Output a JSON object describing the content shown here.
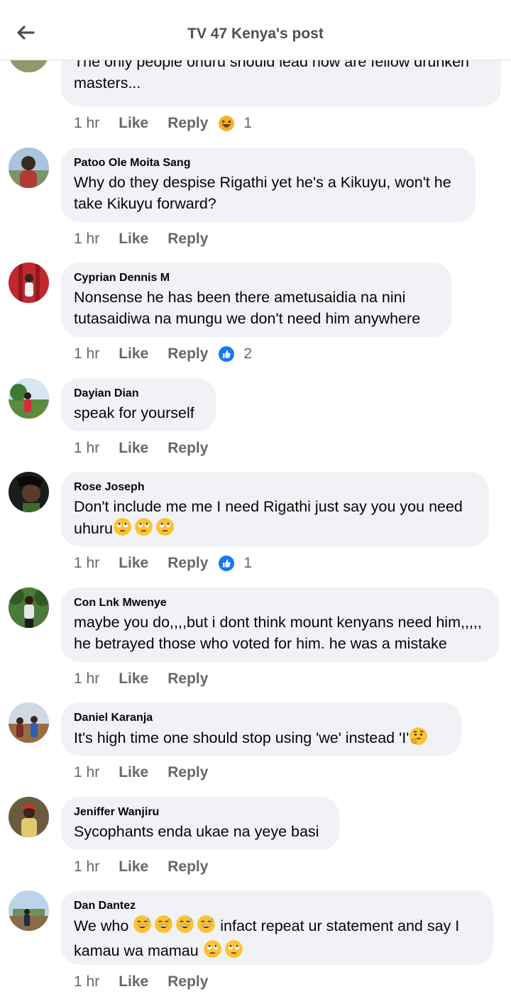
{
  "header": {
    "title": "TV 47 Kenya's post"
  },
  "actions": {
    "like_label": "Like",
    "reply_label": "Reply"
  },
  "comments": [
    {
      "author": "",
      "line1": "The only people ohuru should lead now are fellow drunken",
      "line2": "masters...",
      "time": "1 hr",
      "reaction": "haha-icon",
      "reaction_count": "1"
    },
    {
      "author": "Patoo Ole Moita Sang",
      "line1": "Why do they despise Rigathi yet he's a Kikuyu, won't he",
      "line2": "take Kikuyu forward?",
      "time": "1 hr"
    },
    {
      "author": "Cyprian Dennis M",
      "line1": "Nonsense he has been there ametusaidia na nini",
      "line2": "tutasaidiwa na mungu we don't need him anywhere",
      "time": "1 hr",
      "reaction": "thumbs-up-icon",
      "reaction_count": "2"
    },
    {
      "author": "Dayian Dian",
      "line1": "speak for yourself",
      "time": "1 hr"
    },
    {
      "author": "Rose Joseph",
      "line1": "Don't include me me I need Rigathi just say you you need",
      "line2": "uhuru",
      "line2_emoji": [
        "eye-roll-emoji",
        "eye-roll-emoji",
        "eye-roll-emoji"
      ],
      "time": "1 hr",
      "reaction": "thumbs-up-icon",
      "reaction_count": "1"
    },
    {
      "author": "Con Lnk Mwenye",
      "line1": "maybe you do,,,,but i dont think mount kenyans need him,,,,,",
      "line2": "he betrayed those who voted for him. he was a mistake",
      "time": "1 hr"
    },
    {
      "author": "Daniel Karanja",
      "line1": "It's high time one should stop using 'we' instead 'I'",
      "line1_emoji": [
        "thinking-emoji"
      ],
      "time": "1 hr"
    },
    {
      "author": "Jeniffer Wanjiru",
      "line1": "Sycophants enda ukae na yeye basi",
      "time": "1 hr"
    },
    {
      "author": "Dan Dantez",
      "line1a": "We who",
      "line1_emoji": [
        "sweat-smile-emoji",
        "sweat-smile-emoji",
        "sweat-smile-emoji",
        "sweat-smile-emoji"
      ],
      "line1b": "infact repeat ur statement and say I",
      "line2": "kamau wa mamau",
      "line2_emoji": [
        "eye-roll-emoji",
        "eye-roll-emoji"
      ],
      "time": "1 hr"
    }
  ]
}
